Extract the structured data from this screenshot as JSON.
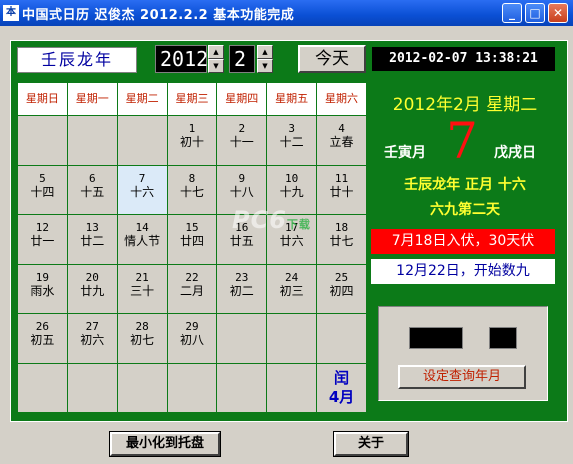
{
  "window": {
    "title": "中国式日历  迟俊杰  2012.2.2  基本功能完成",
    "app_icon": "本"
  },
  "header": {
    "ganzhi_year": "壬辰龙年",
    "year_value": "2012",
    "month_value": "2",
    "today_label": "今天",
    "clock": "2012-02-07 13:38:21"
  },
  "calendar": {
    "weekdays": [
      "星期日",
      "星期一",
      "星期二",
      "星期三",
      "星期四",
      "星期五",
      "星期六"
    ],
    "rows": [
      [
        {
          "n": "",
          "l": ""
        },
        {
          "n": "",
          "l": ""
        },
        {
          "n": "",
          "l": ""
        },
        {
          "n": "1",
          "l": "初十"
        },
        {
          "n": "2",
          "l": "十一"
        },
        {
          "n": "3",
          "l": "十二"
        },
        {
          "n": "4",
          "l": "立春"
        }
      ],
      [
        {
          "n": "5",
          "l": "十四"
        },
        {
          "n": "6",
          "l": "十五"
        },
        {
          "n": "7",
          "l": "十六"
        },
        {
          "n": "8",
          "l": "十七"
        },
        {
          "n": "9",
          "l": "十八"
        },
        {
          "n": "10",
          "l": "十九"
        },
        {
          "n": "11",
          "l": "廿十"
        }
      ],
      [
        {
          "n": "12",
          "l": "廿一"
        },
        {
          "n": "13",
          "l": "廿二"
        },
        {
          "n": "14",
          "l": "情人节"
        },
        {
          "n": "15",
          "l": "廿四"
        },
        {
          "n": "16",
          "l": "廿五"
        },
        {
          "n": "17",
          "l": "廿六"
        },
        {
          "n": "18",
          "l": "廿七"
        }
      ],
      [
        {
          "n": "19",
          "l": "雨水"
        },
        {
          "n": "20",
          "l": "廿九"
        },
        {
          "n": "21",
          "l": "三十"
        },
        {
          "n": "22",
          "l": "二月"
        },
        {
          "n": "23",
          "l": "初二"
        },
        {
          "n": "24",
          "l": "初三"
        },
        {
          "n": "25",
          "l": "初四"
        }
      ],
      [
        {
          "n": "26",
          "l": "初五"
        },
        {
          "n": "27",
          "l": "初六"
        },
        {
          "n": "28",
          "l": "初七"
        },
        {
          "n": "29",
          "l": "初八"
        },
        {
          "n": "",
          "l": ""
        },
        {
          "n": "",
          "l": ""
        },
        {
          "n": "",
          "l": ""
        }
      ],
      [
        {
          "n": "",
          "l": ""
        },
        {
          "n": "",
          "l": ""
        },
        {
          "n": "",
          "l": ""
        },
        {
          "n": "",
          "l": ""
        },
        {
          "n": "",
          "l": ""
        },
        {
          "n": "",
          "l": ""
        },
        {
          "n": "",
          "l": ""
        }
      ]
    ],
    "selected": "7",
    "leap_label": "闰\n4月"
  },
  "info": {
    "date_line": "2012年2月  星期二",
    "big_day": "7",
    "month_ganzhi": "壬寅月",
    "day_ganzhi": "戊戌日",
    "lunar_line": "壬辰龙年  正月  十六",
    "shujiu": "六九第二天",
    "red_note": "7月18日入伏，30天伏",
    "white_note": "12月22日，开始数九"
  },
  "query": {
    "button_label": "设定查询年月"
  },
  "buttons": {
    "minimize_tray": "最小化到托盘",
    "about": "关于"
  },
  "watermark": {
    "main": "PC6",
    "sub": "下载"
  },
  "colors": {
    "panel_green": "#0c7a18",
    "accent_red": "#ff0000",
    "title_blue": "#0a4fd4"
  }
}
